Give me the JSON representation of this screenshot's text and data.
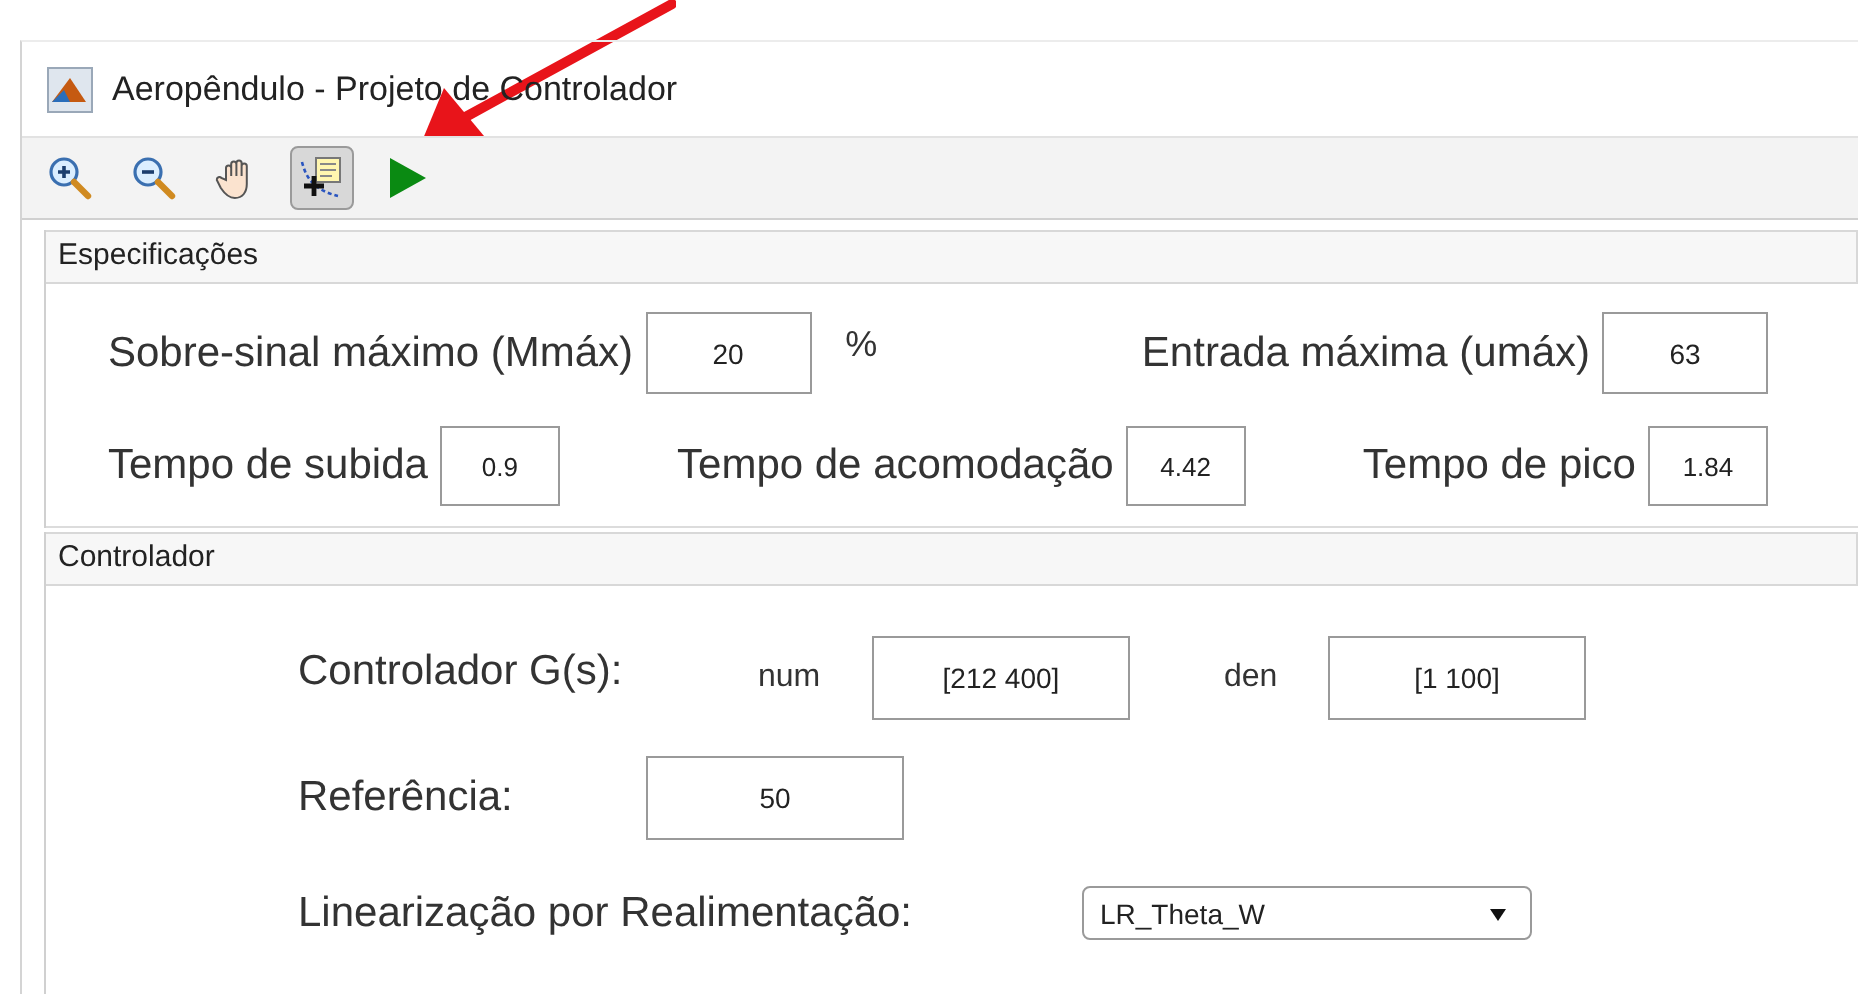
{
  "window": {
    "title": "Aeropêndulo - Projeto de Controlador"
  },
  "toolbar": [
    {
      "kind": "zoom-in",
      "on": false
    },
    {
      "kind": "zoom-out",
      "on": false
    },
    {
      "kind": "pan",
      "on": false
    },
    {
      "kind": "datatip",
      "on": true
    },
    {
      "kind": "run",
      "on": false
    }
  ],
  "annotations": [
    {
      "kind": "arrow"
    }
  ],
  "specifications": {
    "title": "Especificações",
    "rows": [
      [
        {
          "label": "Sobre-sinal máximo (Mmáx)",
          "value": "20",
          "unit": "%"
        },
        {
          "label": "Entrada máxima (umáx)",
          "value": "63"
        }
      ],
      [
        {
          "label": "Tempo de subida",
          "value": "0.9"
        },
        {
          "label": "Tempo de acomodação",
          "value": "4.42"
        },
        {
          "label": "Tempo de pico",
          "value": "1.84"
        }
      ]
    ]
  },
  "controller": {
    "title": "Controlador",
    "transfer": {
      "label": "Controlador G(s):",
      "num_label": "num",
      "num": "[212 400]",
      "den_label": "den",
      "den": "[1 100]"
    },
    "reference": {
      "label": "Referência:",
      "value": "50"
    },
    "linearization": {
      "label": "Linearização por Realimentação:",
      "value": "LR_Theta_W"
    }
  }
}
